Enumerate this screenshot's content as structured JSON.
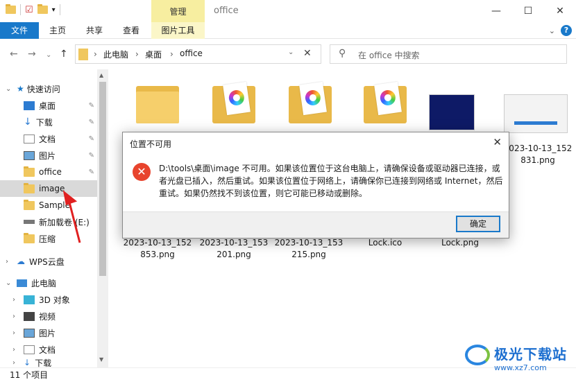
{
  "titlebar": {
    "manage_tab": "管理",
    "window_title": "office"
  },
  "ribbon": {
    "file": "文件",
    "home": "主页",
    "share": "共享",
    "view": "查看",
    "picture_tools": "图片工具",
    "help": "?"
  },
  "address": {
    "crumbs": [
      "此电脑",
      "桌面",
      "office"
    ],
    "sep": "›"
  },
  "search": {
    "placeholder": "在 office 中搜索"
  },
  "sidebar": {
    "quick_access": "快速访问",
    "items": [
      "桌面",
      "下载",
      "文档",
      "图片",
      "office",
      "image",
      "Sample",
      "新加载卷 (E:)",
      "压缩"
    ],
    "wps": "WPS云盘",
    "this_pc": "此电脑",
    "pc_items": [
      "3D 对象",
      "视频",
      "图片",
      "文档",
      "下载"
    ]
  },
  "files": {
    "top_right_label": [
      "2023-10-13_152",
      "831.png"
    ],
    "bottom": [
      [
        "2023-10-13_152",
        "853.png"
      ],
      [
        "2023-10-13_153",
        "201.png"
      ],
      [
        "2023-10-13_153",
        "215.png"
      ],
      [
        "Lock.ico",
        ""
      ],
      [
        "Lock.png",
        ""
      ]
    ]
  },
  "status": {
    "count": "11 个项目"
  },
  "dialog": {
    "title": "位置不可用",
    "message": "D:\\tools\\桌面\\image 不可用。如果该位置位于这台电脑上，请确保设备或驱动器已连接，或者光盘已插入，然后重试。如果该位置位于网络上，请确保你已连接到网络或 Internet，然后重试。如果仍然找不到该位置，则它可能已移动或删除。",
    "ok": "确定"
  },
  "watermark": {
    "main": "极光下载站",
    "sub": "www.xz7.com"
  },
  "colors": {
    "accent": "#1979ca",
    "error": "#e8442d",
    "manage": "#f7eea0"
  }
}
